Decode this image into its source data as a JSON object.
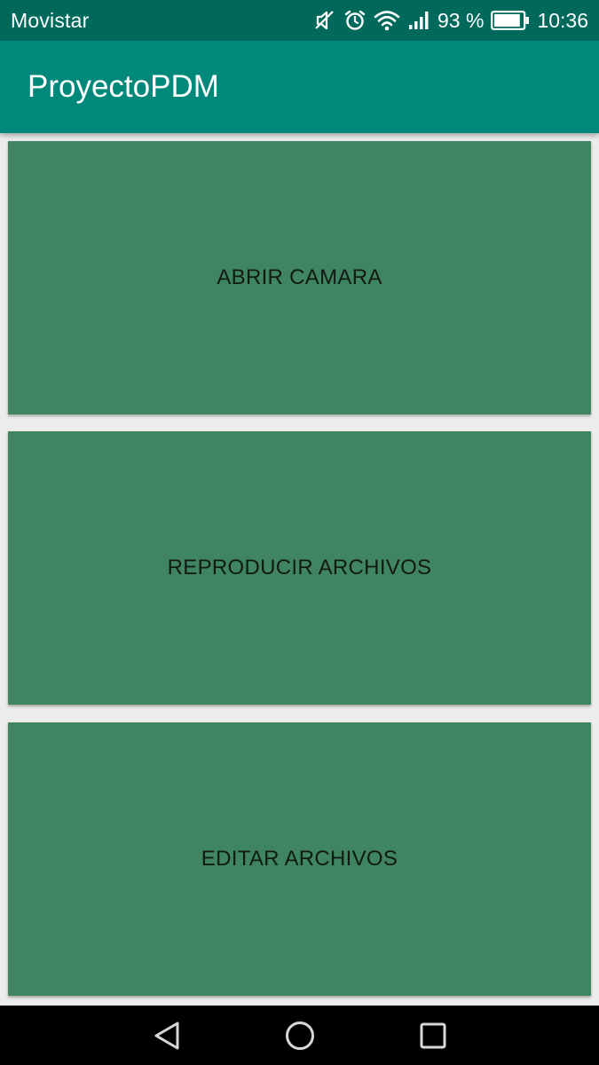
{
  "status_bar": {
    "carrier": "Movistar",
    "icons": [
      "mute-icon",
      "alarm-icon",
      "wifi-icon",
      "signal-icon"
    ],
    "battery_percent": "93 %",
    "time": "10:36",
    "battery_level": 0.93
  },
  "app_bar": {
    "title": "ProyectoPDM"
  },
  "buttons": [
    {
      "label": "ABRIR CAMARA"
    },
    {
      "label": "REPRODUCIR ARCHIVOS"
    },
    {
      "label": "EDITAR ARCHIVOS"
    }
  ],
  "nav_bar": {
    "icons": [
      "back-icon",
      "home-icon",
      "recent-apps-icon"
    ]
  },
  "colors": {
    "status_bar": "#00695c",
    "app_bar": "#00897b",
    "button": "#408561",
    "background": "#ececec"
  }
}
